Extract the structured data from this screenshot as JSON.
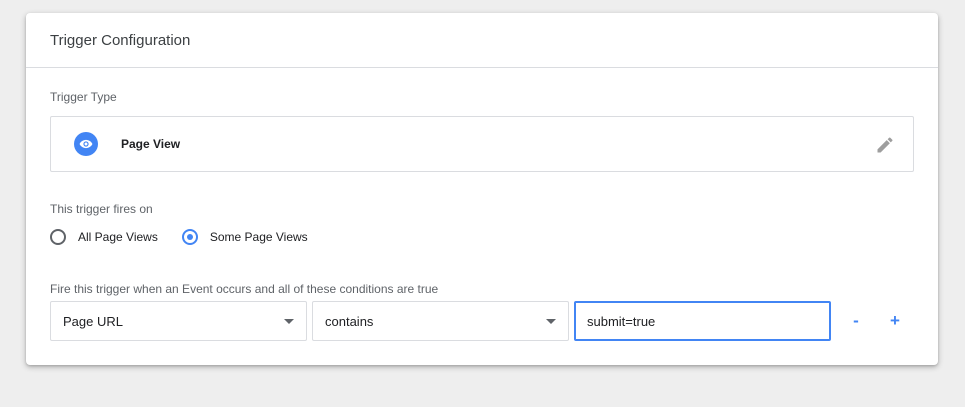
{
  "card": {
    "title": "Trigger Configuration"
  },
  "trigger_type": {
    "label": "Trigger Type",
    "name": "Page View",
    "icon": "eye-icon",
    "edit_icon": "pencil-icon"
  },
  "fires_on": {
    "label": "This trigger fires on",
    "options": [
      {
        "label": "All Page Views",
        "selected": false
      },
      {
        "label": "Some Page Views",
        "selected": true
      }
    ]
  },
  "conditions": {
    "label": "Fire this trigger when an Event occurs and all of these conditions are true",
    "variable": "Page URL",
    "operator": "contains",
    "value": "submit=true",
    "remove_label": "-",
    "add_label": "+"
  },
  "colors": {
    "accent": "#4285f4",
    "border": "#dadce0",
    "background": "#eeeeee"
  }
}
